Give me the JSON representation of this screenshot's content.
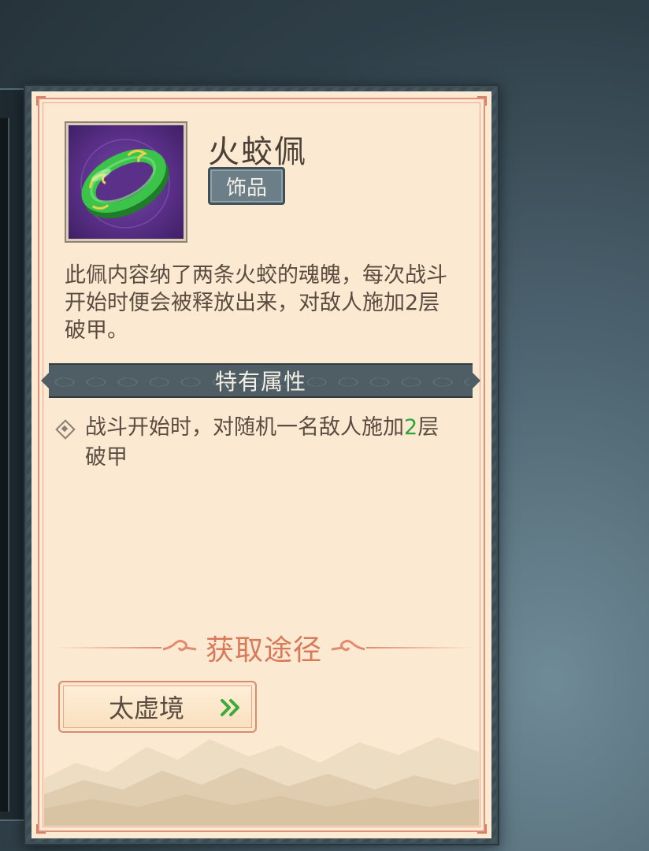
{
  "item": {
    "name": "火蛟佩",
    "type": "饰品",
    "icon": "jade-bracelet-icon",
    "description": "此佩内容纳了两条火蛟的魂魄，每次战斗开始时便会被释放出来，对敌人施加2层破甲。"
  },
  "special_attributes": {
    "title": "特有属性",
    "attributes": [
      {
        "text_before": "战斗开始时，对随机一名敌人施加",
        "highlight": "2",
        "text_after": "层破甲"
      }
    ]
  },
  "acquisition": {
    "title": "获取途径",
    "sources": [
      {
        "label": "太虚境",
        "icon": "double-chevron-right-icon"
      }
    ]
  },
  "colors": {
    "card_background": "#fbead1",
    "accent_border": "#e0917a",
    "highlight_green": "#2ea43a",
    "section_bar": "#4f5e65"
  }
}
